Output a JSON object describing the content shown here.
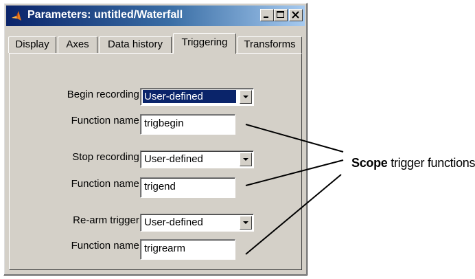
{
  "window": {
    "title": "Parameters: untitled/Waterfall",
    "minimize_icon": "minimize-icon",
    "maximize_icon": "maximize-icon",
    "close_icon": "close-icon",
    "app_icon": "matlab-icon"
  },
  "tabs": [
    {
      "label": "Display",
      "active": false
    },
    {
      "label": "Axes",
      "active": false
    },
    {
      "label": "Data history",
      "active": false
    },
    {
      "label": "Triggering",
      "active": true
    },
    {
      "label": "Transforms",
      "active": false
    }
  ],
  "form": {
    "begin_recording": {
      "label": "Begin recording:",
      "value": "User-defined"
    },
    "begin_function": {
      "label": "Function name:",
      "value": "trigbegin"
    },
    "stop_recording": {
      "label": "Stop recording:",
      "value": "User-defined"
    },
    "stop_function": {
      "label": "Function name:",
      "value": "trigend"
    },
    "rearm_trigger": {
      "label": "Re-arm trigger:",
      "value": "User-defined"
    },
    "rearm_function": {
      "label": "Function name:",
      "value": "trigrearm"
    }
  },
  "annotation": {
    "bold": "Scope",
    "rest": " trigger functions"
  },
  "colors": {
    "title_bar": "#0a246a",
    "window_bg": "#d4d0c8",
    "selection": "#0a246a"
  }
}
